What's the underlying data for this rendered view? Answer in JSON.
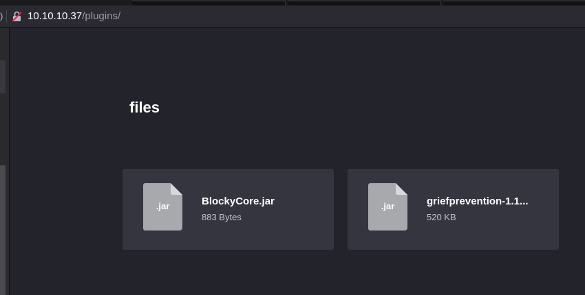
{
  "browser": {
    "address_host": "10.10.10.37",
    "address_path": "/plugins/",
    "left_edge_glyph": ")"
  },
  "page": {
    "title": "files"
  },
  "files": [
    {
      "icon_label": ".jar",
      "name": "BlockyCore.jar",
      "size": "883 Bytes"
    },
    {
      "icon_label": ".jar",
      "name": "griefprevention-1.1...",
      "size": "520 KB"
    }
  ],
  "colors": {
    "background": "#23232b",
    "card": "#35353f",
    "file_icon": "#a7a9ad",
    "lock_accent": "#e22850"
  }
}
